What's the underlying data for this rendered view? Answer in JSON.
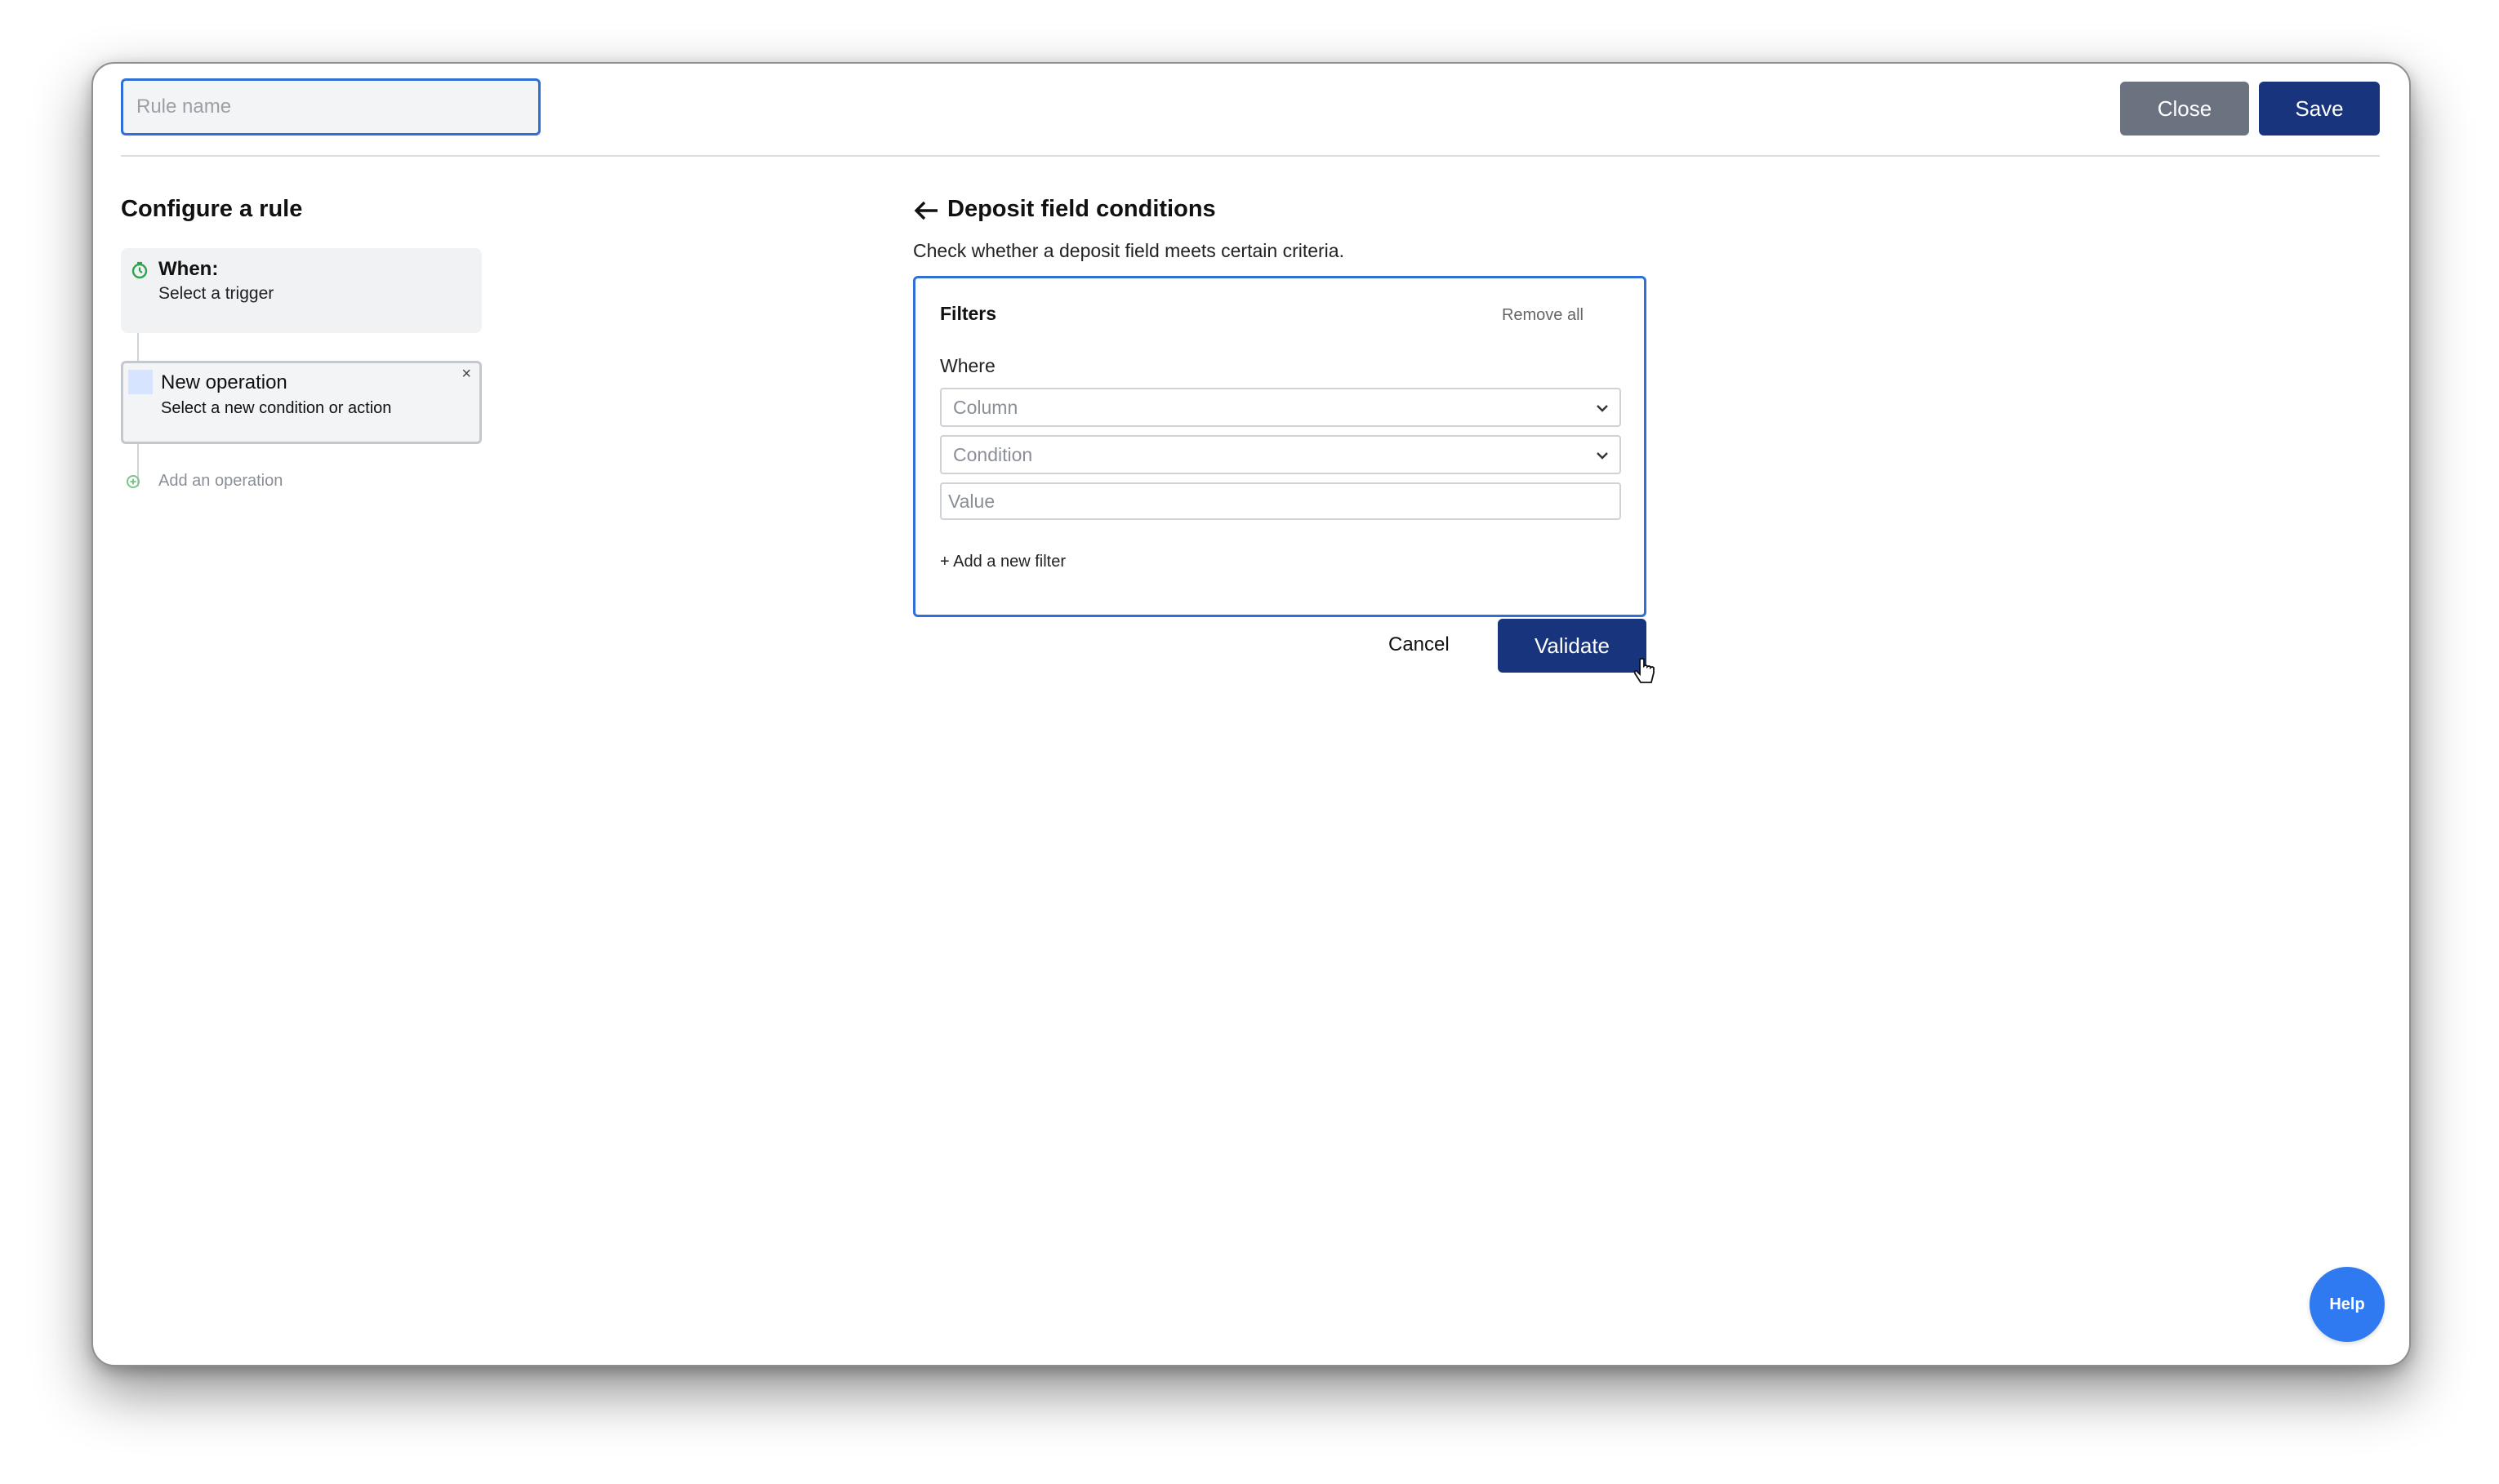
{
  "header": {
    "rule_name_placeholder": "Rule name",
    "rule_name_value": "",
    "close_label": "Close",
    "save_label": "Save"
  },
  "sidebar": {
    "title": "Configure a rule",
    "trigger": {
      "title": "When:",
      "subtitle": "Select a trigger",
      "icon": "clock-icon"
    },
    "operation": {
      "title": "New operation",
      "subtitle": "Select a new condition or action",
      "close_glyph": "×"
    },
    "add_operation_label": "Add an operation"
  },
  "panel": {
    "title": "Deposit field conditions",
    "description": "Check whether a deposit field meets certain criteria.",
    "filters": {
      "title": "Filters",
      "remove_all_label": "Remove all",
      "where_label": "Where",
      "column_placeholder": "Column",
      "condition_placeholder": "Condition",
      "value_placeholder": "Value",
      "add_filter_label": "+ Add a new filter"
    },
    "cancel_label": "Cancel",
    "validate_label": "Validate"
  },
  "help_label": "Help",
  "colors": {
    "primary": "#18347c",
    "secondary_button": "#6b7380",
    "focus_border": "#2f6fd6",
    "help_button": "#2f7af0",
    "trigger_icon": "#2ea44f"
  }
}
